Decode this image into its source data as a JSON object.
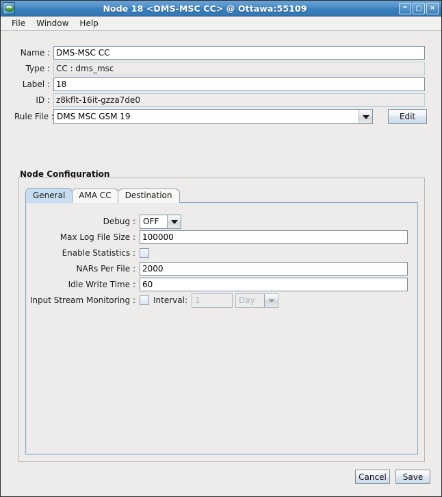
{
  "window": {
    "title": "Node 18 <DMS-MSC CC> @ Ottawa:55109",
    "app_icon": "app-icon",
    "minimize_label": "–",
    "maximize_label": "□",
    "close_label": "✕"
  },
  "menubar": {
    "items": [
      {
        "label": "File"
      },
      {
        "label": "Window"
      },
      {
        "label": "Help"
      }
    ]
  },
  "form": {
    "name": {
      "label": "Name :",
      "value": "DMS-MSC CC"
    },
    "type": {
      "label": "Type :",
      "value": "CC : dms_msc"
    },
    "label_field": {
      "label": "Label :",
      "value": "18"
    },
    "id": {
      "label": "ID :",
      "value": "z8kflt-16it-gzza7de0"
    },
    "rule_file": {
      "label": "Rule File :",
      "value": "DMS MSC GSM 19"
    },
    "edit_button": "Edit"
  },
  "node_configuration": {
    "title": "Node  Configuration",
    "tabs": [
      {
        "label": "General",
        "active": true
      },
      {
        "label": "AMA CC",
        "active": false
      },
      {
        "label": "Destination",
        "active": false
      }
    ],
    "general": {
      "debug": {
        "label": "Debug :",
        "value": "OFF"
      },
      "max_log_file_size": {
        "label": "Max Log File Size :",
        "value": "100000"
      },
      "enable_statistics": {
        "label": "Enable Statistics :",
        "checked": false
      },
      "nars_per_file": {
        "label": "NARs Per File :",
        "value": "2000"
      },
      "idle_write_time": {
        "label": "Idle Write Time :",
        "value": "60"
      },
      "input_stream_monitoring": {
        "label": "Input Stream Monitoring :",
        "checked": false,
        "interval_label": "Interval:",
        "interval_value": "1",
        "unit_value": "Day"
      }
    }
  },
  "footer": {
    "cancel_label": "Cancel",
    "save_label": "Save"
  },
  "colors": {
    "titlebar_start": "#6ba3d6",
    "titlebar_end": "#3178b5",
    "active_tab": "#c8ddf2",
    "panel_bg": "#edeceb",
    "field_border": "#7b8da0",
    "readonly_border": "#b9cbdd"
  }
}
